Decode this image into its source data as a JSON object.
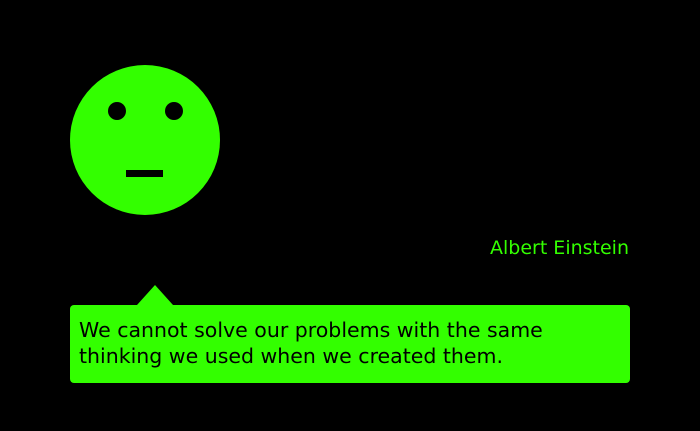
{
  "face": {
    "icon": "neutral-face-icon",
    "color": "#33FF00"
  },
  "author": {
    "name": "Albert Einstein"
  },
  "quote": {
    "text": "We cannot solve our problems with the same thinking we used when we created them."
  },
  "colors": {
    "background": "#000000",
    "accent": "#33FF00",
    "text_on_accent": "#000000"
  }
}
